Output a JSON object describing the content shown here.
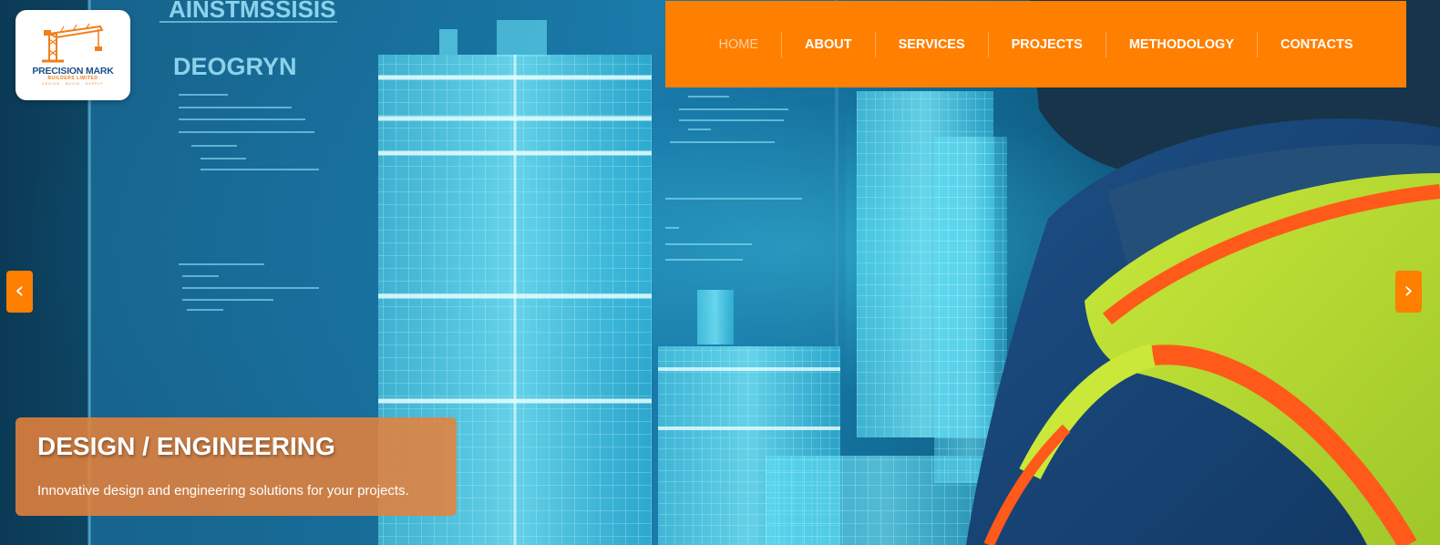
{
  "brand": {
    "name": "PRECISION MARK",
    "subtitle": "BUILDERS LIMITED",
    "tagline": "DESIGN · BUILD · SUPPLY"
  },
  "nav": {
    "items": [
      {
        "label": "HOME",
        "active": true
      },
      {
        "label": "ABOUT",
        "active": false
      },
      {
        "label": "SERVICES",
        "active": false
      },
      {
        "label": "PROJECTS",
        "active": false
      },
      {
        "label": "METHODOLOGY",
        "active": false
      },
      {
        "label": "CONTACTS",
        "active": false
      }
    ]
  },
  "slider": {
    "prev_icon": "chevron-left-icon",
    "prev_glyph": "‹",
    "next_icon": "chevron-right-icon",
    "next_glyph": "›",
    "caption": {
      "title": "DESIGN / ENGINEERING",
      "text": "Innovative design and engineering solutions for your projects."
    },
    "screen_text": {
      "heading_top": "AINSTMSSISIS",
      "heading": "DEOGRYN"
    }
  },
  "colors": {
    "accent": "#ff7f00",
    "caption_bg": "#e4823c",
    "hologram": "#3fd6f2",
    "logo_blue": "#1b4f8a"
  }
}
